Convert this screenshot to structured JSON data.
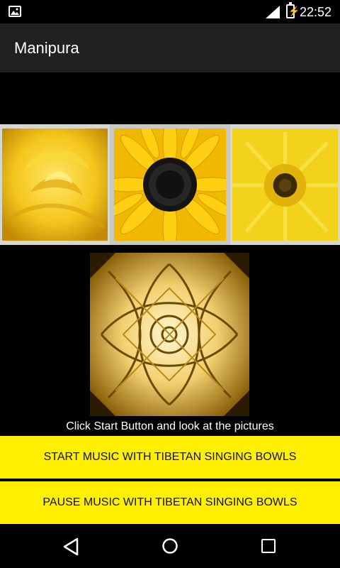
{
  "status_bar": {
    "time": "22:52",
    "icons": [
      "image-notification-icon",
      "signal-icon",
      "battery-charging-icon"
    ]
  },
  "app_bar": {
    "title": "Manipura"
  },
  "gallery": {
    "images": [
      "yellow-rose-image",
      "black-eyed-susan-image",
      "yellow-gerbera-image"
    ],
    "selected_index": 1
  },
  "mandala": {
    "image": "golden-mandala-image"
  },
  "hint_text": "Click Start Button and look at the pictures",
  "buttons": {
    "start_label": "START MUSIC WITH TIBETAN SINGING BOWLS",
    "pause_label": "PAUSE MUSIC WITH TIBETAN SINGING BOWLS"
  },
  "colors": {
    "button_bg": "#ffef00",
    "app_bar_bg": "#212121",
    "background": "#000000"
  },
  "nav_bar": {
    "icons": [
      "back-icon",
      "home-icon",
      "recent-apps-icon"
    ]
  }
}
